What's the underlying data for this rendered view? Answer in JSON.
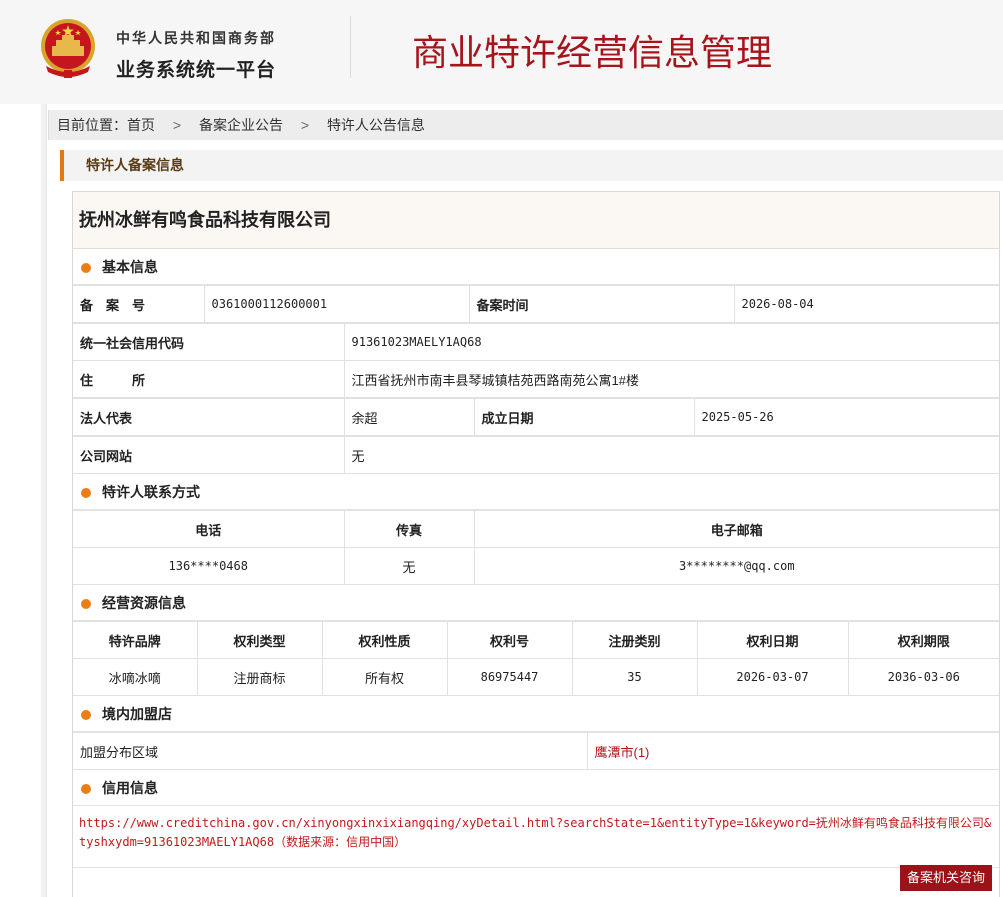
{
  "header": {
    "ministry": "中华人民共和国商务部",
    "platform": "业务系统统一平台",
    "system_title": "商业特许经营信息管理"
  },
  "breadcrumb": {
    "prefix": "目前位置：",
    "items": [
      "首页",
      "备案企业公告",
      "特许人公告信息"
    ],
    "separator": ">"
  },
  "section_title": "特许人备案信息",
  "company_name": "抚州冰鲜有鸣食品科技有限公司",
  "basic": {
    "heading": "基本信息",
    "filing_no_label": "备　案　号",
    "filing_no": "0361000112600001",
    "filing_time_label": "备案时间",
    "filing_time": "2026-08-04",
    "credit_code_label": "统一社会信用代码",
    "credit_code": "91361023MAELY1AQ68",
    "address_label": "住　　　所",
    "address": "江西省抚州市南丰县琴城镇桔苑西路南苑公寓1#楼",
    "legal_rep_label": "法人代表",
    "legal_rep": "余超",
    "founded_label": "成立日期",
    "founded": "2025-05-26",
    "website_label": "公司网站",
    "website": "无"
  },
  "contact": {
    "heading": "特许人联系方式",
    "headers": [
      "电话",
      "传真",
      "电子邮箱"
    ],
    "phone": "136****0468",
    "fax": "无",
    "email": "3********@qq.com"
  },
  "resources": {
    "heading": "经营资源信息",
    "headers": [
      "特许品牌",
      "权利类型",
      "权利性质",
      "权利号",
      "注册类别",
      "权利日期",
      "权利期限"
    ],
    "row": [
      "冰嘀冰嘀",
      "注册商标",
      "所有权",
      "86975447",
      "35",
      "2026-03-07",
      "2036-03-06"
    ]
  },
  "stores": {
    "heading": "境内加盟店",
    "region_label": "加盟分布区域",
    "region_value": "鹰潭市(1)"
  },
  "credit": {
    "heading": "信用信息",
    "text": "https://www.creditchina.gov.cn/xinyongxinxixiangqing/xyDetail.html?searchState=1&entityType=1&keyword=抚州冰鲜有鸣食品科技有限公司&tyshxydm=91361023MAELY1AQ68（数据来源：信用中国）"
  },
  "consult_button": "备案机关咨询",
  "colors": {
    "brand_red": "#a6151b",
    "accent_orange": "#ea7e13",
    "button_red": "#9b1218"
  }
}
